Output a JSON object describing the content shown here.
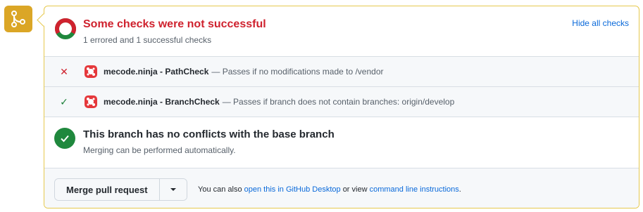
{
  "header": {
    "title": "Some checks were not successful",
    "subtitle": "1 errored and 1 successful checks",
    "hide_link": "Hide all checks"
  },
  "checks": [
    {
      "status": "error",
      "name": "mecode.ninja - PathCheck",
      "description": "— Passes if no modifications made to /vendor"
    },
    {
      "status": "success",
      "name": "mecode.ninja - BranchCheck",
      "description": "— Passes if branch does not contain branches: origin/develop"
    }
  ],
  "conflicts": {
    "title": "This branch has no conflicts with the base branch",
    "subtitle": "Merging can be performed automatically."
  },
  "merge": {
    "button_label": "Merge pull request",
    "hint_prefix": "You can also",
    "desktop_link": "open this in GitHub Desktop",
    "hint_middle": "or view",
    "cli_link": "command line instructions",
    "hint_suffix": "."
  },
  "colors": {
    "error": "#cf222e",
    "success": "#1a7f37",
    "accent": "#dba626",
    "link": "#0969da"
  }
}
